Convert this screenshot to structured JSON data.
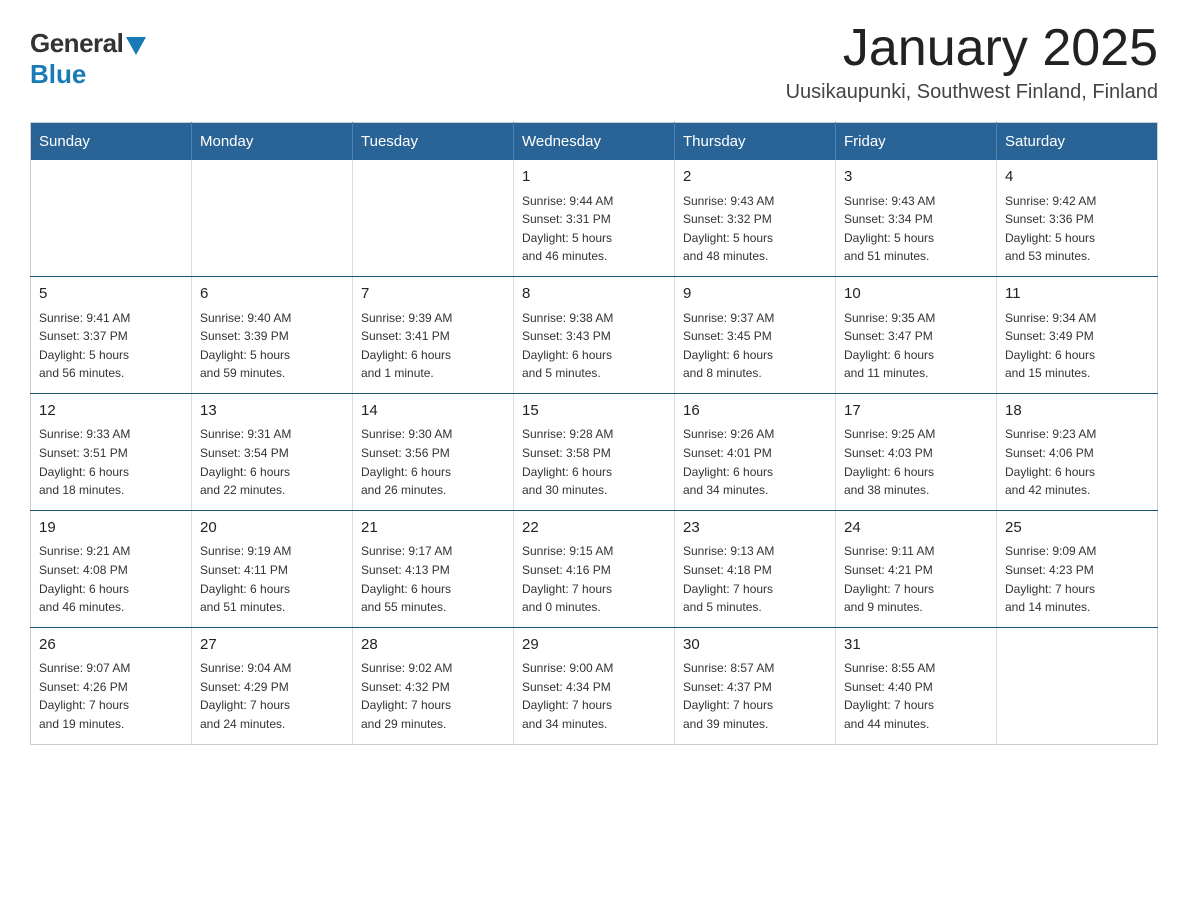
{
  "logo": {
    "general": "General",
    "blue": "Blue"
  },
  "header": {
    "title": "January 2025",
    "location": "Uusikaupunki, Southwest Finland, Finland"
  },
  "days_of_week": [
    "Sunday",
    "Monday",
    "Tuesday",
    "Wednesday",
    "Thursday",
    "Friday",
    "Saturday"
  ],
  "weeks": [
    [
      {
        "day": "",
        "info": ""
      },
      {
        "day": "",
        "info": ""
      },
      {
        "day": "",
        "info": ""
      },
      {
        "day": "1",
        "info": "Sunrise: 9:44 AM\nSunset: 3:31 PM\nDaylight: 5 hours\nand 46 minutes."
      },
      {
        "day": "2",
        "info": "Sunrise: 9:43 AM\nSunset: 3:32 PM\nDaylight: 5 hours\nand 48 minutes."
      },
      {
        "day": "3",
        "info": "Sunrise: 9:43 AM\nSunset: 3:34 PM\nDaylight: 5 hours\nand 51 minutes."
      },
      {
        "day": "4",
        "info": "Sunrise: 9:42 AM\nSunset: 3:36 PM\nDaylight: 5 hours\nand 53 minutes."
      }
    ],
    [
      {
        "day": "5",
        "info": "Sunrise: 9:41 AM\nSunset: 3:37 PM\nDaylight: 5 hours\nand 56 minutes."
      },
      {
        "day": "6",
        "info": "Sunrise: 9:40 AM\nSunset: 3:39 PM\nDaylight: 5 hours\nand 59 minutes."
      },
      {
        "day": "7",
        "info": "Sunrise: 9:39 AM\nSunset: 3:41 PM\nDaylight: 6 hours\nand 1 minute."
      },
      {
        "day": "8",
        "info": "Sunrise: 9:38 AM\nSunset: 3:43 PM\nDaylight: 6 hours\nand 5 minutes."
      },
      {
        "day": "9",
        "info": "Sunrise: 9:37 AM\nSunset: 3:45 PM\nDaylight: 6 hours\nand 8 minutes."
      },
      {
        "day": "10",
        "info": "Sunrise: 9:35 AM\nSunset: 3:47 PM\nDaylight: 6 hours\nand 11 minutes."
      },
      {
        "day": "11",
        "info": "Sunrise: 9:34 AM\nSunset: 3:49 PM\nDaylight: 6 hours\nand 15 minutes."
      }
    ],
    [
      {
        "day": "12",
        "info": "Sunrise: 9:33 AM\nSunset: 3:51 PM\nDaylight: 6 hours\nand 18 minutes."
      },
      {
        "day": "13",
        "info": "Sunrise: 9:31 AM\nSunset: 3:54 PM\nDaylight: 6 hours\nand 22 minutes."
      },
      {
        "day": "14",
        "info": "Sunrise: 9:30 AM\nSunset: 3:56 PM\nDaylight: 6 hours\nand 26 minutes."
      },
      {
        "day": "15",
        "info": "Sunrise: 9:28 AM\nSunset: 3:58 PM\nDaylight: 6 hours\nand 30 minutes."
      },
      {
        "day": "16",
        "info": "Sunrise: 9:26 AM\nSunset: 4:01 PM\nDaylight: 6 hours\nand 34 minutes."
      },
      {
        "day": "17",
        "info": "Sunrise: 9:25 AM\nSunset: 4:03 PM\nDaylight: 6 hours\nand 38 minutes."
      },
      {
        "day": "18",
        "info": "Sunrise: 9:23 AM\nSunset: 4:06 PM\nDaylight: 6 hours\nand 42 minutes."
      }
    ],
    [
      {
        "day": "19",
        "info": "Sunrise: 9:21 AM\nSunset: 4:08 PM\nDaylight: 6 hours\nand 46 minutes."
      },
      {
        "day": "20",
        "info": "Sunrise: 9:19 AM\nSunset: 4:11 PM\nDaylight: 6 hours\nand 51 minutes."
      },
      {
        "day": "21",
        "info": "Sunrise: 9:17 AM\nSunset: 4:13 PM\nDaylight: 6 hours\nand 55 minutes."
      },
      {
        "day": "22",
        "info": "Sunrise: 9:15 AM\nSunset: 4:16 PM\nDaylight: 7 hours\nand 0 minutes."
      },
      {
        "day": "23",
        "info": "Sunrise: 9:13 AM\nSunset: 4:18 PM\nDaylight: 7 hours\nand 5 minutes."
      },
      {
        "day": "24",
        "info": "Sunrise: 9:11 AM\nSunset: 4:21 PM\nDaylight: 7 hours\nand 9 minutes."
      },
      {
        "day": "25",
        "info": "Sunrise: 9:09 AM\nSunset: 4:23 PM\nDaylight: 7 hours\nand 14 minutes."
      }
    ],
    [
      {
        "day": "26",
        "info": "Sunrise: 9:07 AM\nSunset: 4:26 PM\nDaylight: 7 hours\nand 19 minutes."
      },
      {
        "day": "27",
        "info": "Sunrise: 9:04 AM\nSunset: 4:29 PM\nDaylight: 7 hours\nand 24 minutes."
      },
      {
        "day": "28",
        "info": "Sunrise: 9:02 AM\nSunset: 4:32 PM\nDaylight: 7 hours\nand 29 minutes."
      },
      {
        "day": "29",
        "info": "Sunrise: 9:00 AM\nSunset: 4:34 PM\nDaylight: 7 hours\nand 34 minutes."
      },
      {
        "day": "30",
        "info": "Sunrise: 8:57 AM\nSunset: 4:37 PM\nDaylight: 7 hours\nand 39 minutes."
      },
      {
        "day": "31",
        "info": "Sunrise: 8:55 AM\nSunset: 4:40 PM\nDaylight: 7 hours\nand 44 minutes."
      },
      {
        "day": "",
        "info": ""
      }
    ]
  ]
}
